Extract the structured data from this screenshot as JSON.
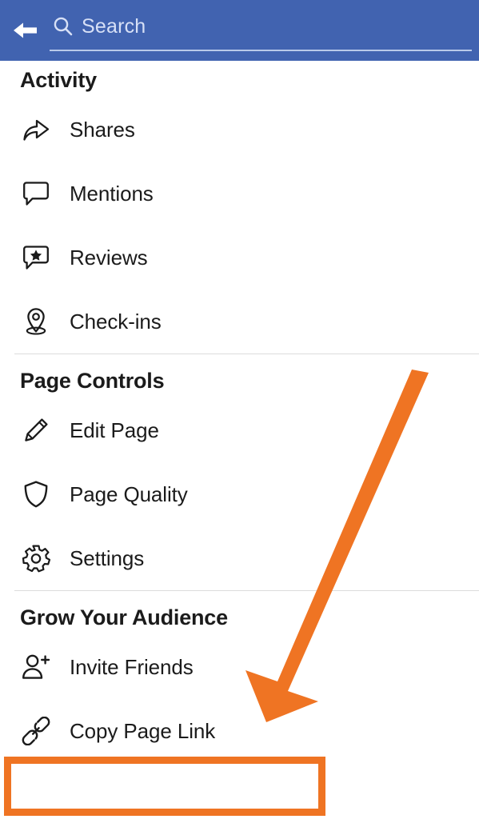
{
  "app": {
    "title": "Facebook Page Menu",
    "header_color": "#4163b0",
    "accent_color": "#ef7423",
    "text_color": "#1b1b1b"
  },
  "header": {
    "back_icon": "arrow-left-icon",
    "search_icon": "search-icon",
    "search_value": "",
    "search_placeholder": "Search"
  },
  "sections": [
    {
      "title": "Activity",
      "items": [
        {
          "label": "Shares",
          "icon": "share-arrow-icon"
        },
        {
          "label": "Mentions",
          "icon": "speech-bubble-icon"
        },
        {
          "label": "Reviews",
          "icon": "speech-bubble-star-icon"
        },
        {
          "label": "Check-ins",
          "icon": "location-pin-icon"
        }
      ]
    },
    {
      "title": "Page Controls",
      "items": [
        {
          "label": "Edit Page",
          "icon": "pencil-icon"
        },
        {
          "label": "Page Quality",
          "icon": "shield-icon"
        },
        {
          "label": "Settings",
          "icon": "gear-icon"
        }
      ]
    },
    {
      "title": "Grow Your Audience",
      "items": [
        {
          "label": "Invite Friends",
          "icon": "person-plus-icon"
        },
        {
          "label": "Copy Page Link",
          "icon": "chain-link-icon"
        }
      ]
    }
  ],
  "annotations": {
    "highlight_target": "Copy Page Link",
    "highlight_color": "#ef7423",
    "arrow_color": "#ef7423",
    "arrow_from": "top-right",
    "arrow_to": "Copy Page Link"
  }
}
